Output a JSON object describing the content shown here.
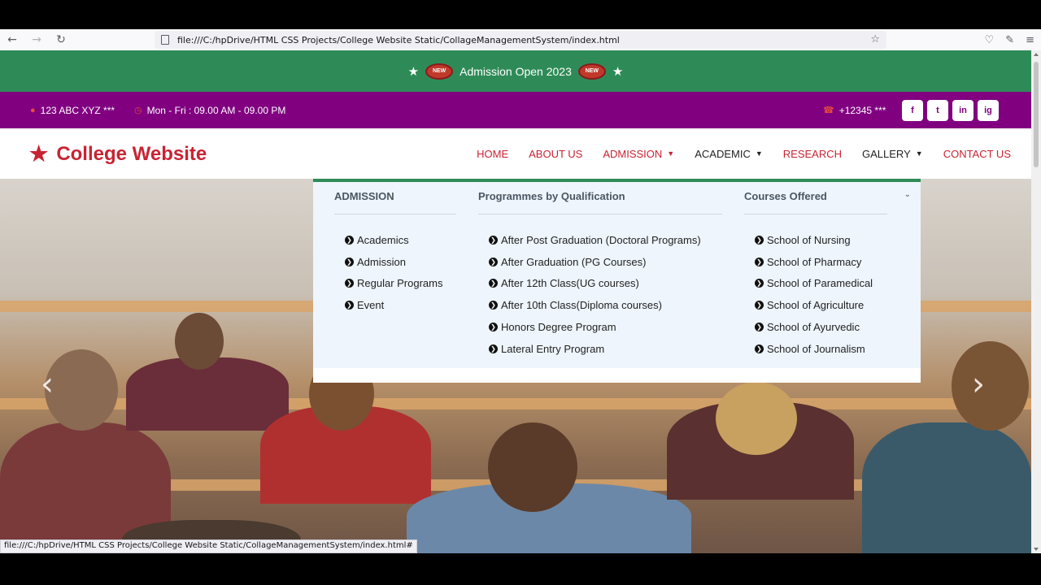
{
  "browser": {
    "url": "file:///C:/hpDrive/HTML CSS Projects/College Website Static/CollageManagementSystem/index.html",
    "status_url": "file:///C:/hpDrive/HTML CSS Projects/College Website Static/CollageManagementSystem/index.html#"
  },
  "announcement": {
    "badge": "NEW",
    "text": "Admission Open 2023"
  },
  "topbar": {
    "address": "123 ABC XYZ ***",
    "hours": "Mon - Fri : 09.00 AM - 09.00 PM",
    "phone": "+12345 ***",
    "social": [
      "f",
      "t",
      "in",
      "ig"
    ]
  },
  "brand": {
    "name": "College Website"
  },
  "menu": {
    "home": "HOME",
    "about": "ABOUT US",
    "admission": "ADMISSION",
    "academic": "ACADEMIC",
    "research": "RESEARCH",
    "gallery": "GALLERY",
    "contact": "CONTACT US"
  },
  "mega": {
    "col1": {
      "title": "ADMISSION",
      "items": [
        "Academics",
        "Admission",
        "Regular Programs",
        "Event"
      ]
    },
    "col2": {
      "title": "Programmes by Qualification",
      "items": [
        "After Post Graduation (Doctoral Programs)",
        "After Graduation (PG Courses)",
        "After 12th Class(UG courses)",
        "After 10th Class(Diploma courses)",
        "Honors Degree Program",
        "Lateral Entry Program"
      ]
    },
    "col3": {
      "title": "Courses Offered",
      "items": [
        "School of Nursing",
        "School of Pharmacy",
        "School of Paramedical",
        "School of Agriculture",
        "School of Ayurvedic",
        "School of Journalism"
      ]
    }
  },
  "colors": {
    "green": "#2e8b57",
    "purple": "#800080",
    "red": "#c82333"
  }
}
